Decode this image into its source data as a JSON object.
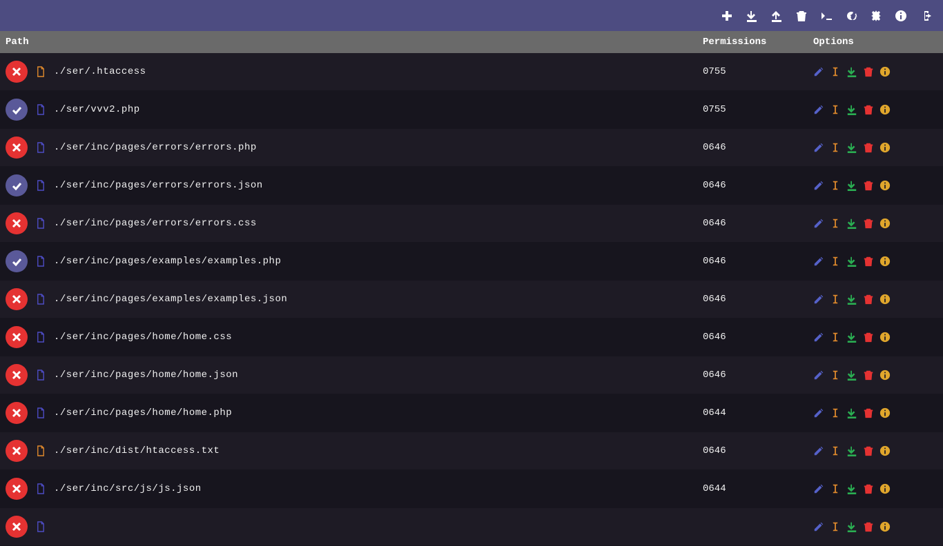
{
  "header": {
    "path": "Path",
    "permissions": "Permissions",
    "options": "Options"
  },
  "toolbar_icons": [
    "plus",
    "download",
    "upload",
    "trash",
    "terminal",
    "refresh",
    "settings",
    "info",
    "signout"
  ],
  "row_option_icons": [
    "edit",
    "rename",
    "download",
    "delete",
    "info"
  ],
  "files": [
    {
      "status": "err",
      "icon_color": "orange",
      "path": "./ser/.htaccess",
      "perm": "0755"
    },
    {
      "status": "ok",
      "icon_color": "indigo",
      "path": "./ser/vvv2.php",
      "perm": "0755"
    },
    {
      "status": "err",
      "icon_color": "indigo",
      "path": "./ser/inc/pages/errors/errors.php",
      "perm": "0646"
    },
    {
      "status": "ok",
      "icon_color": "indigo",
      "path": "./ser/inc/pages/errors/errors.json",
      "perm": "0646"
    },
    {
      "status": "err",
      "icon_color": "indigo",
      "path": "./ser/inc/pages/errors/errors.css",
      "perm": "0646"
    },
    {
      "status": "ok",
      "icon_color": "indigo",
      "path": "./ser/inc/pages/examples/examples.php",
      "perm": "0646"
    },
    {
      "status": "err",
      "icon_color": "indigo",
      "path": "./ser/inc/pages/examples/examples.json",
      "perm": "0646"
    },
    {
      "status": "err",
      "icon_color": "indigo",
      "path": "./ser/inc/pages/home/home.css",
      "perm": "0646"
    },
    {
      "status": "err",
      "icon_color": "indigo",
      "path": "./ser/inc/pages/home/home.json",
      "perm": "0646"
    },
    {
      "status": "err",
      "icon_color": "indigo",
      "path": "./ser/inc/pages/home/home.php",
      "perm": "0644"
    },
    {
      "status": "err",
      "icon_color": "orange",
      "path": "./ser/inc/dist/htaccess.txt",
      "perm": "0646"
    },
    {
      "status": "err",
      "icon_color": "indigo",
      "path": "./ser/inc/src/js/js.json",
      "perm": "0644"
    },
    {
      "status": "err",
      "icon_color": "indigo",
      "path": "",
      "perm": ""
    }
  ]
}
